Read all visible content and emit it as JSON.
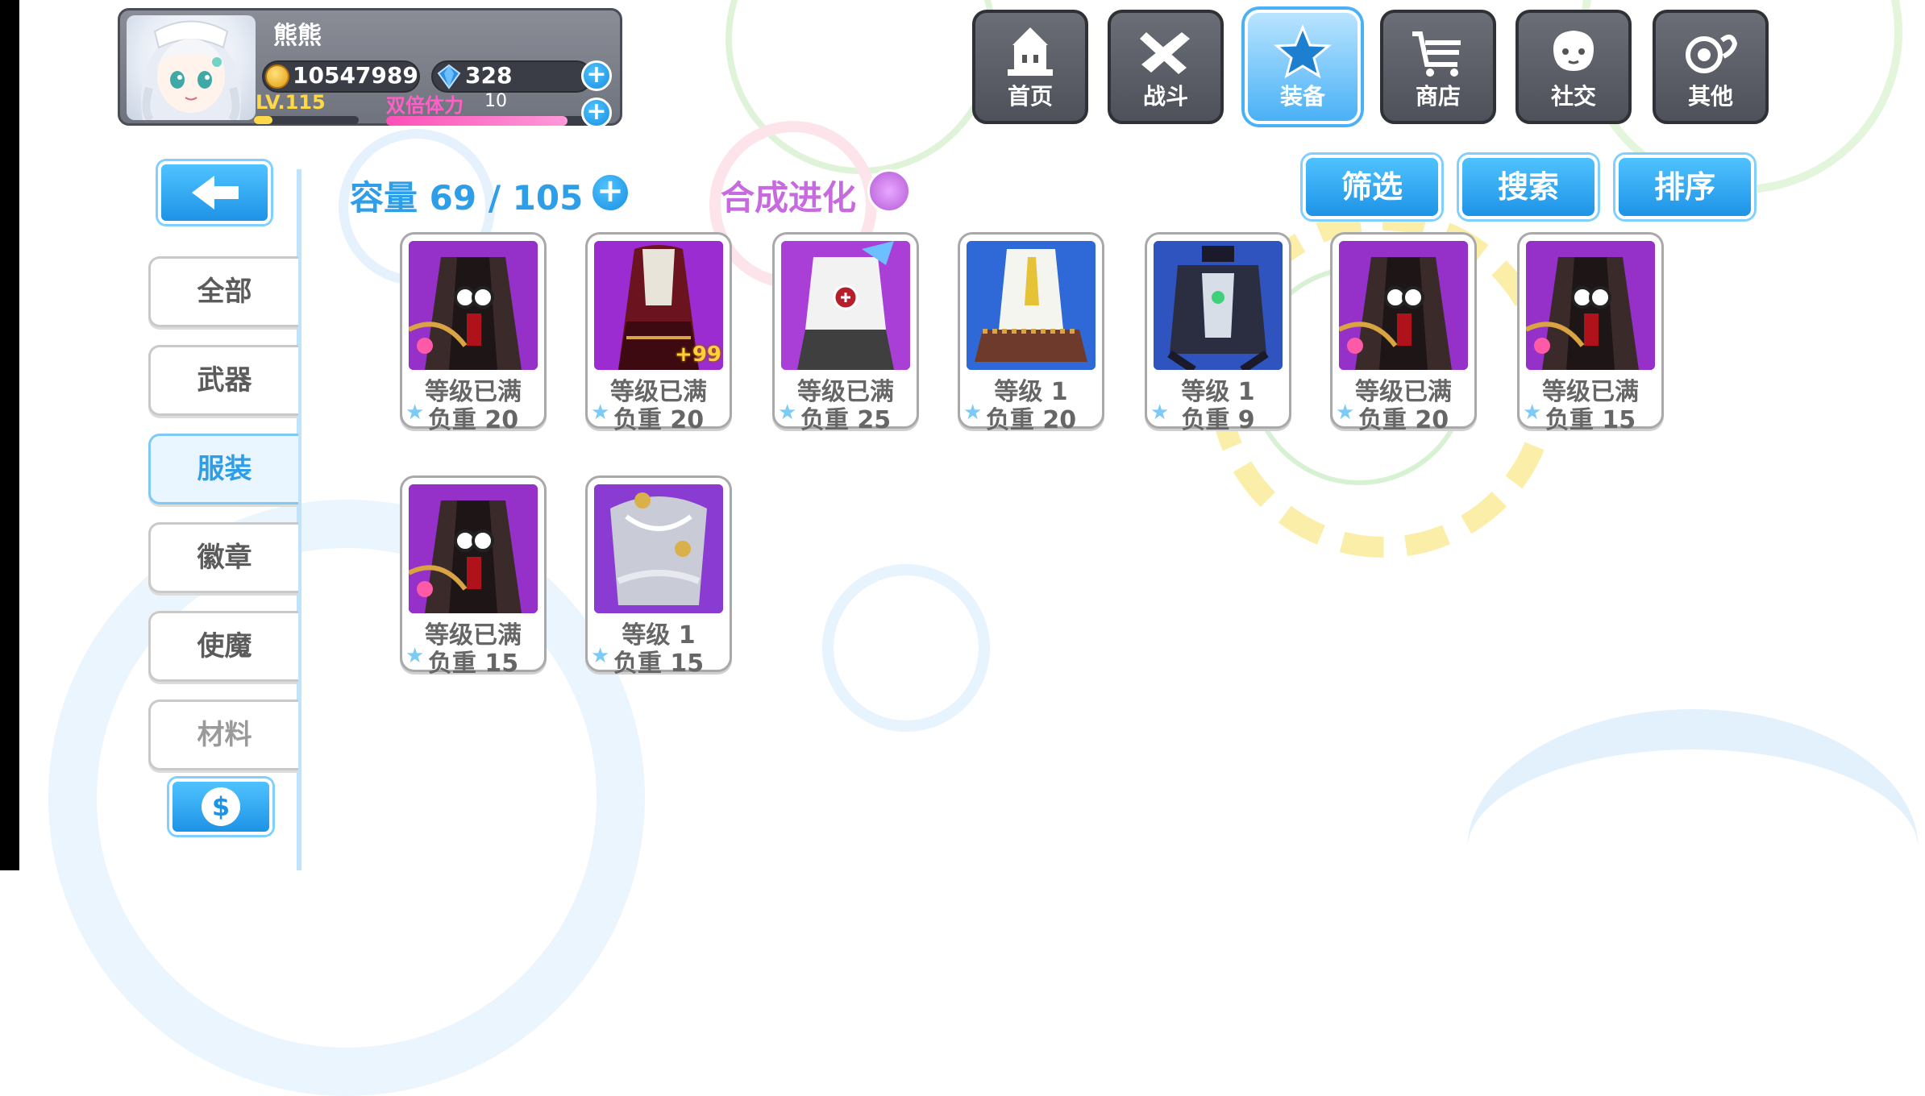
{
  "player": {
    "name": "熊熊",
    "gold": "10547989",
    "gems": "328",
    "level": "LV.115",
    "stamina_label": "双倍体力",
    "stamina_value": "10",
    "exp_progress": 0.18,
    "stamina_progress": 0.9
  },
  "nav": {
    "items": [
      {
        "label": "首页",
        "icon": "home-icon",
        "active": false
      },
      {
        "label": "战斗",
        "icon": "battle-icon",
        "active": false
      },
      {
        "label": "装备",
        "icon": "equipment-icon",
        "active": true
      },
      {
        "label": "商店",
        "icon": "shop-icon",
        "active": false
      },
      {
        "label": "社交",
        "icon": "social-icon",
        "active": false
      },
      {
        "label": "其他",
        "icon": "other-icon",
        "active": false
      }
    ]
  },
  "sidebar": {
    "tabs": [
      {
        "label": "全部",
        "active": false
      },
      {
        "label": "武器",
        "active": false
      },
      {
        "label": "服装",
        "active": true
      },
      {
        "label": "徽章",
        "active": false
      },
      {
        "label": "使魔",
        "active": false
      },
      {
        "label": "材料",
        "active": false
      }
    ]
  },
  "header": {
    "capacity": "容量 69 / 105",
    "synth": "合成进化",
    "filter": "筛选",
    "search": "搜索",
    "sort": "排序"
  },
  "items": [
    {
      "level": "等级已满",
      "weight": "负重 20",
      "art": "purple-gown",
      "badge": ""
    },
    {
      "level": "等级已满",
      "weight": "负重 20",
      "art": "purple-cloak",
      "badge": "+99"
    },
    {
      "level": "等级已满",
      "weight": "负重 25",
      "art": "white-outfit",
      "badge": ""
    },
    {
      "level": "等级 1",
      "weight": "负重 20",
      "art": "blue-dress",
      "badge": ""
    },
    {
      "level": "等级 1",
      "weight": "负重 9",
      "art": "blue-armor",
      "badge": ""
    },
    {
      "level": "等级已满",
      "weight": "负重 20",
      "art": "purple-gown",
      "badge": ""
    },
    {
      "level": "等级已满",
      "weight": "负重 15",
      "art": "purple-gown",
      "badge": ""
    },
    {
      "level": "等级已满",
      "weight": "负重 15",
      "art": "purple-gown",
      "badge": ""
    },
    {
      "level": "等级 1",
      "weight": "负重 15",
      "art": "silver-ribbon",
      "badge": ""
    }
  ],
  "colors": {
    "accent": "#2e9ee8",
    "synth": "#c86adf",
    "gold": "#ffd84a",
    "stamina": "#ff5fc6"
  }
}
